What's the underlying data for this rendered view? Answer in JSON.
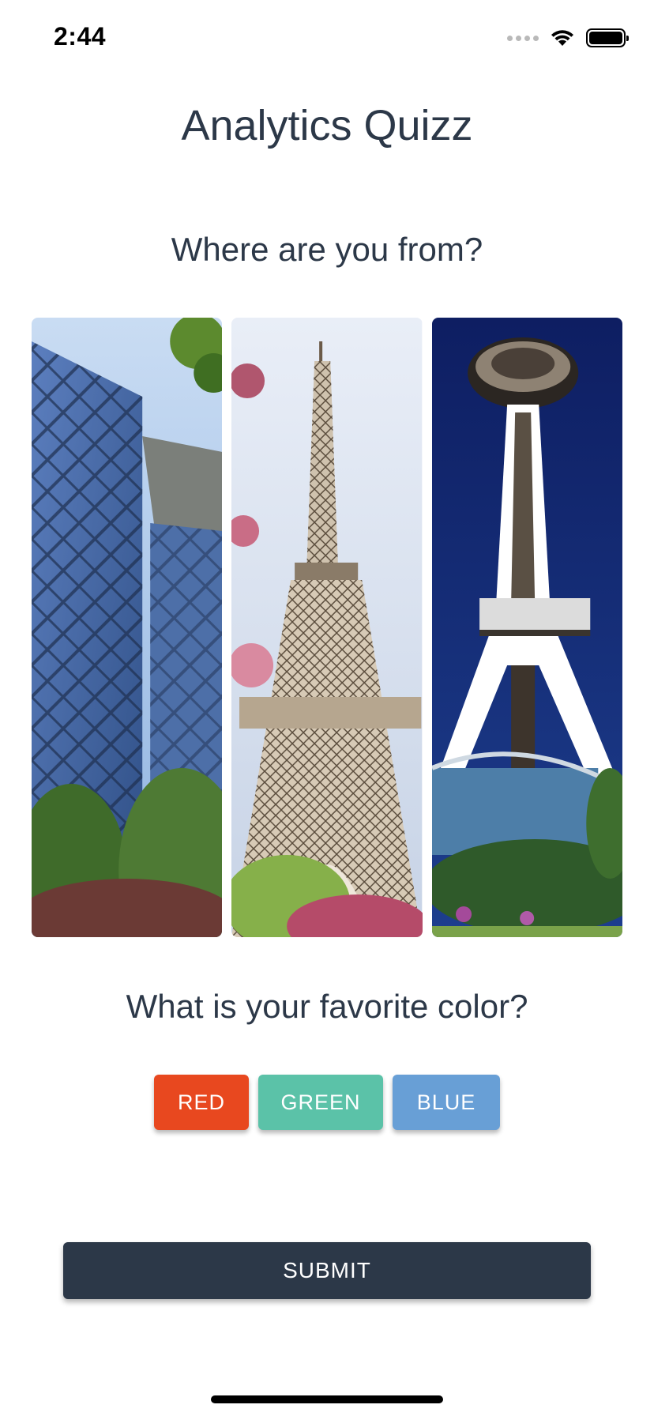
{
  "status_bar": {
    "time": "2:44"
  },
  "app": {
    "title": "Analytics Quizz"
  },
  "questions": {
    "origin": {
      "text": "Where are you from?",
      "options": [
        {
          "icon": "cctv-tower-beijing-photo"
        },
        {
          "icon": "eiffel-tower-paris-photo"
        },
        {
          "icon": "space-needle-seattle-photo"
        }
      ]
    },
    "color": {
      "text": "What is your favorite color?",
      "options": [
        {
          "label": "RED",
          "color": "#e8481f"
        },
        {
          "label": "GREEN",
          "color": "#5bc2a8"
        },
        {
          "label": "BLUE",
          "color": "#689fd6"
        }
      ]
    }
  },
  "submit": {
    "label": "SUBMIT",
    "color": "#2c3848"
  }
}
